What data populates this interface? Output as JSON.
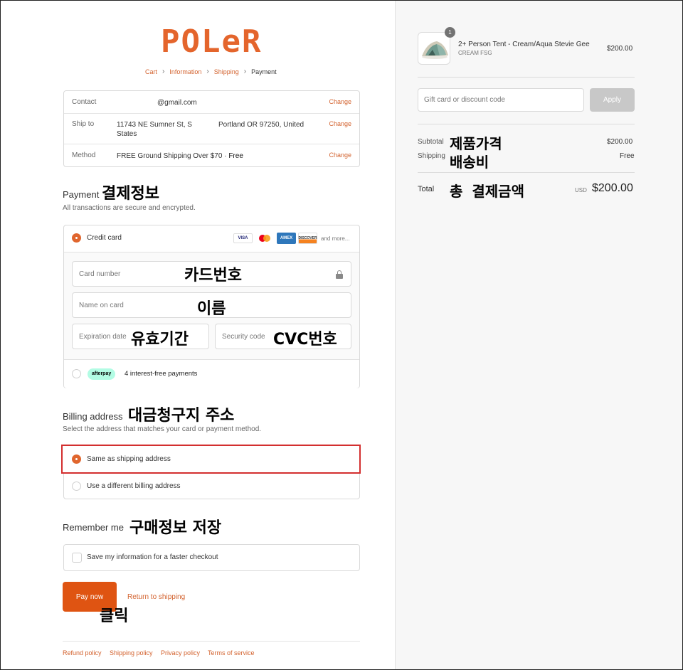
{
  "brand": {
    "logo_text": "POLeR",
    "color": "#e4652c"
  },
  "breadcrumb": [
    {
      "label": "Cart"
    },
    {
      "label": "Information"
    },
    {
      "label": "Shipping"
    },
    {
      "label": "Payment"
    }
  ],
  "review": {
    "contact_label": "Contact",
    "contact_value": "@gmail.com",
    "ship_label": "Ship to",
    "ship_value_line1": "11743 NE Sumner St, S",
    "ship_value_line2": "States",
    "ship_value_city": "Portland OR 97250, United",
    "method_label": "Method",
    "method_value": "FREE Ground Shipping Over $70 · ",
    "method_price": "Free",
    "change_label": "Change"
  },
  "payment": {
    "title": "Payment",
    "annotation": "결제정보",
    "subtitle": "All transactions are secure and encrypted.",
    "credit_label": "Credit card",
    "card_brands": [
      "VISA",
      "MC",
      "AMEX",
      "DISCOVER"
    ],
    "and_more": "and more...",
    "card_number_placeholder": "Card number",
    "card_number_annotation": "카드번호",
    "name_placeholder": "Name on card",
    "name_annotation": "이름",
    "expiry_placeholder": "Expiration date",
    "expiry_annotation": "유효기간",
    "security_placeholder": "Security code",
    "security_annotation": "CVC번호",
    "afterpay_badge": "afterpay",
    "afterpay_label": "4 interest-free payments"
  },
  "billing": {
    "title": "Billing address",
    "annotation": "대금청구지 주소",
    "subtitle": "Select the address that matches your card or payment method.",
    "same_label": "Same as shipping address",
    "different_label": "Use a different billing address"
  },
  "remember": {
    "title": "Remember me",
    "annotation": "구매정보 저장",
    "checkbox_label": "Save my information for a faster checkout"
  },
  "actions": {
    "pay_label": "Pay now",
    "pay_annotation": "클릭",
    "return_label": "Return to shipping"
  },
  "footer": [
    "Refund policy",
    "Shipping policy",
    "Privacy policy",
    "Terms of service"
  ],
  "order": {
    "quantity": "1",
    "product_name": "2+ Person Tent - Cream/Aqua Stevie Gee",
    "product_variant": "CREAM FSG",
    "product_price": "$200.00",
    "discount_placeholder": "Gift card or discount code",
    "apply_label": "Apply",
    "subtotal_label": "Subtotal",
    "subtotal_annotation": "제품가격",
    "subtotal_value": "$200.00",
    "shipping_label": "Shipping",
    "shipping_annotation": "배송비",
    "shipping_value": "Free",
    "total_label": "Total",
    "total_annotation": "총 결제금액",
    "currency": "USD",
    "total_value": "$200.00"
  },
  "colors": {
    "accent": "#d3622e",
    "pay_button": "#df5412",
    "highlight": "#d32f2f"
  }
}
